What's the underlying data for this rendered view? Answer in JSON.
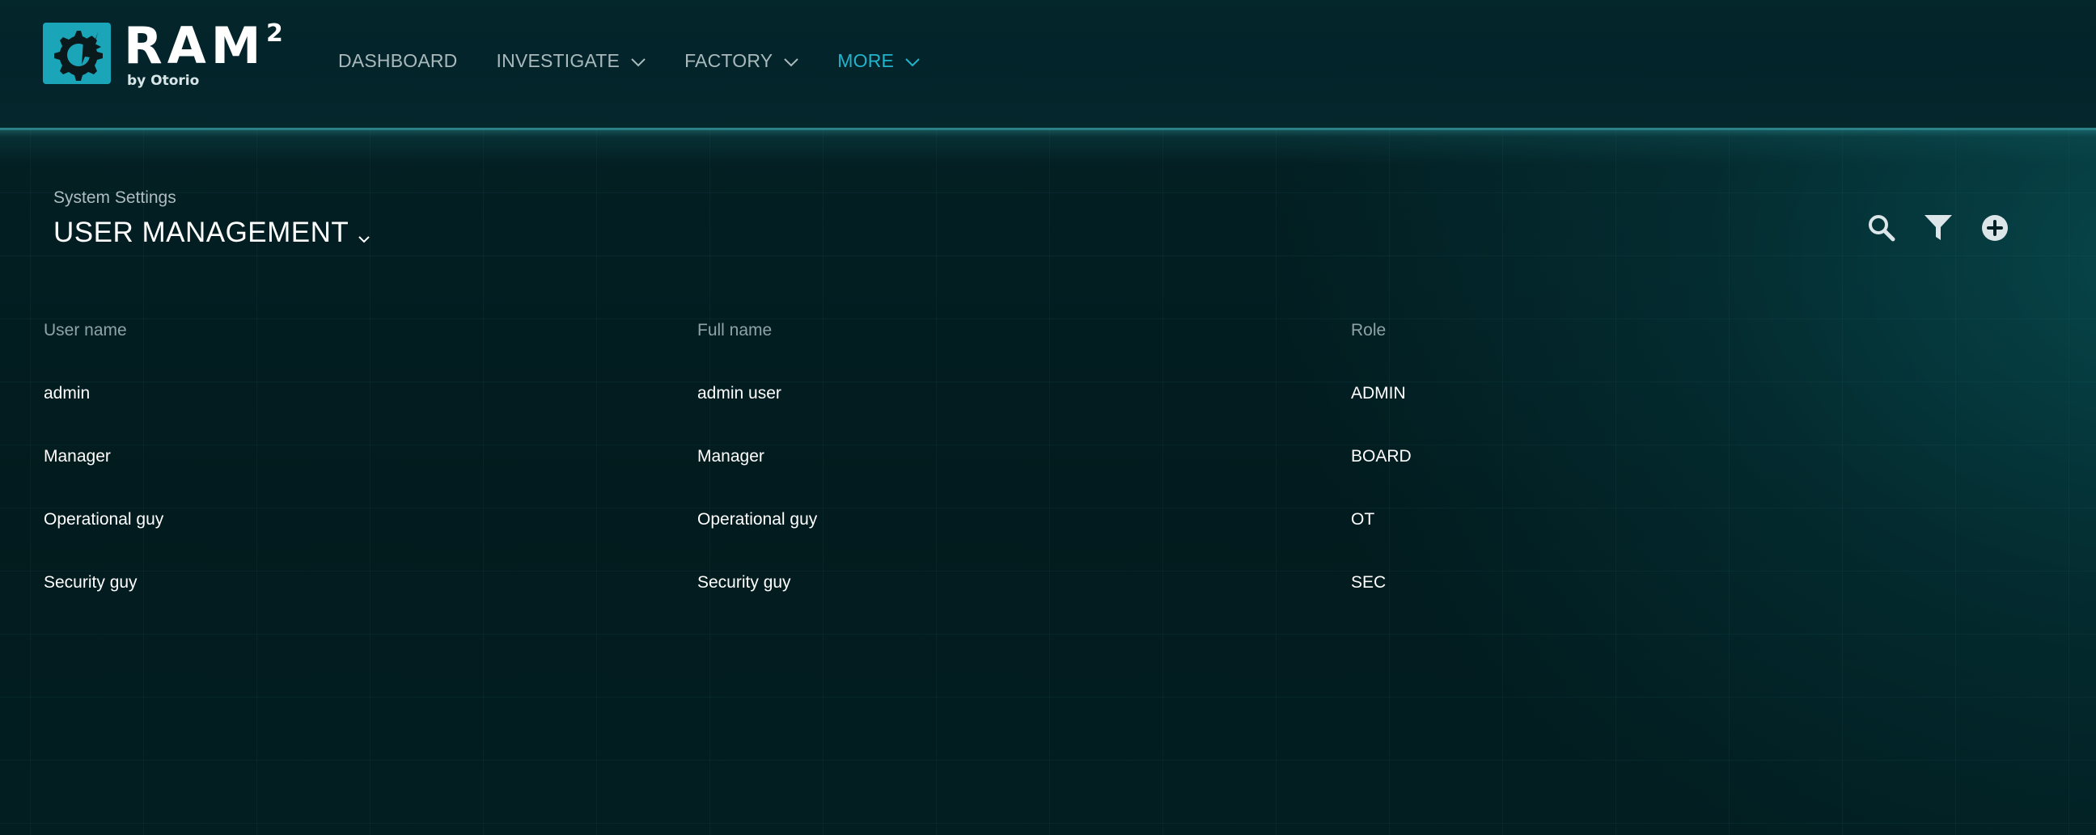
{
  "brand": {
    "name": "RAM",
    "superscript": "2",
    "byline": "by Otorio"
  },
  "nav": [
    {
      "label": "DASHBOARD",
      "has_dropdown": false,
      "active": false
    },
    {
      "label": "INVESTIGATE",
      "has_dropdown": true,
      "active": false
    },
    {
      "label": "FACTORY",
      "has_dropdown": true,
      "active": false
    },
    {
      "label": "MORE",
      "has_dropdown": true,
      "active": true
    }
  ],
  "page": {
    "breadcrumb": "System Settings",
    "title": "USER MANAGEMENT"
  },
  "toolbar": {
    "icons": [
      "search-icon",
      "filter-icon",
      "add-circle-icon"
    ]
  },
  "table": {
    "columns": [
      "User name",
      "Full name",
      "Role"
    ],
    "rows": [
      [
        "admin",
        "admin user",
        "ADMIN"
      ],
      [
        "Manager",
        "Manager",
        "BOARD"
      ],
      [
        "Operational guy",
        "Operational guy",
        "OT"
      ],
      [
        "Security guy",
        "Security guy",
        "SEC"
      ]
    ]
  },
  "colors": {
    "accent": "#22b3cc",
    "logo": "#1aa6b8",
    "background": "#021a1d",
    "nav_text": "#a9b9bc",
    "header_text_muted": "#8fa3a7"
  }
}
